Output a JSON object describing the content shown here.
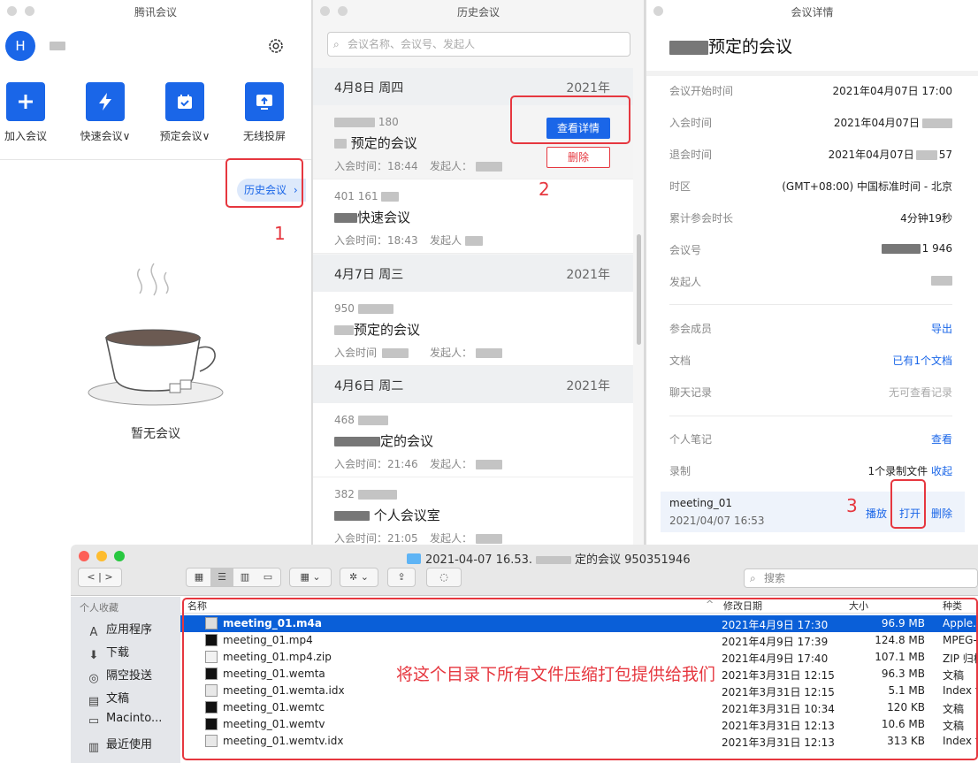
{
  "tencent_main": {
    "title": "腾讯会议",
    "avatar_letter": "H",
    "actions": [
      {
        "label": "加入会议",
        "icon": "plus-icon"
      },
      {
        "label": "快速会议∨",
        "icon": "lightning-icon"
      },
      {
        "label": "预定会议∨",
        "icon": "calendar-icon"
      },
      {
        "label": "无线投屏",
        "icon": "screen-cast-icon"
      }
    ],
    "history_button": "历史会议",
    "history_chevron": "›",
    "empty_text": "暂无会议",
    "annotation_1": "1"
  },
  "history": {
    "title": "历史会议",
    "search_placeholder": "会议名称、会议号、发起人",
    "groups": [
      {
        "date": "4月8日 周四",
        "year": "2021年"
      },
      {
        "date": "4月7日 周三",
        "year": "2021年"
      },
      {
        "date": "4月6日 周二",
        "year": "2021年"
      }
    ],
    "items": [
      {
        "id": "180",
        "name": "预定的会议",
        "time": "入会时间：18:44",
        "by": "发起人："
      },
      {
        "id": "401 161",
        "name": "快速会议",
        "time": "入会时间：18:43",
        "by": "发起人"
      },
      {
        "id": "950",
        "name": "预定的会议",
        "time": "入会时间",
        "by": "发起人："
      },
      {
        "id": "468",
        "name": "定的会议",
        "time": "入会时间：21:46",
        "by": "发起人："
      },
      {
        "id": "382",
        "name": "个人会议室",
        "time": "入会时间：21:05",
        "by": "发起人："
      }
    ],
    "detail_button": "查看详情",
    "delete_button": "删除",
    "annotation_2": "2"
  },
  "detail": {
    "window_title": "会议详情",
    "title": "预定的会议",
    "rows": [
      {
        "key": "会议开始时间",
        "value": "2021年04月07日 17:00"
      },
      {
        "key": "入会时间",
        "value": "2021年04月07日"
      },
      {
        "key": "退会时间",
        "value": "2021年04月07日"
      },
      {
        "key": "时区",
        "value": "(GMT+08:00) 中国标准时间 - 北京"
      },
      {
        "key": "累计参会时长",
        "value": "4分钟19秒"
      },
      {
        "key": "会议号",
        "value": "1 946"
      },
      {
        "key": "发起人",
        "value": ""
      }
    ],
    "leave_suffix": "57",
    "members_label": "参会成员",
    "members_action": "导出",
    "docs_label": "文档",
    "docs_value": "已有1个文档",
    "chat_label": "聊天记录",
    "chat_value": "无可查看记录",
    "notes_label": "个人笔记",
    "notes_action": "查看",
    "record_label": "录制",
    "record_value": "1个录制文件",
    "record_collapse": "收起",
    "record_name": "meeting_01",
    "record_date": "2021/04/07 16:53",
    "play": "播放",
    "open": "打开",
    "delete": "删除",
    "annotation_3": "3"
  },
  "finder": {
    "title_prefix": "2021-04-07 16.53.",
    "title_suffix": "定的会议 950351946",
    "search_placeholder": "搜索",
    "sidebar_header": "个人收藏",
    "sidebar": [
      {
        "label": "应用程序",
        "icon": "applications-icon",
        "glyph": "A"
      },
      {
        "label": "下载",
        "icon": "download-icon",
        "glyph": "⬇"
      },
      {
        "label": "隔空投送",
        "icon": "airdrop-icon",
        "glyph": "◎"
      },
      {
        "label": "文稿",
        "icon": "documents-icon",
        "glyph": "▤"
      },
      {
        "label": "Macinto...",
        "icon": "disk-icon",
        "glyph": "▭"
      },
      {
        "label": "最近使用",
        "icon": "recents-icon",
        "glyph": "▥"
      }
    ],
    "columns": {
      "name": "名称",
      "modified": "修改日期",
      "size": "大小",
      "kind": "种类"
    },
    "files": [
      {
        "name": "meeting_01.m4a",
        "date": "2021年4月9日 17:30",
        "size": "96.9 MB",
        "kind": "Apple...",
        "icon": "audio-file-icon"
      },
      {
        "name": "meeting_01.mp4",
        "date": "2021年4月9日 17:39",
        "size": "124.8 MB",
        "kind": "MPEG-",
        "icon": "video-file-icon"
      },
      {
        "name": "meeting_01.mp4.zip",
        "date": "2021年4月9日 17:40",
        "size": "107.1 MB",
        "kind": "ZIP 归档",
        "icon": "zip-file-icon"
      },
      {
        "name": "meeting_01.wemta",
        "date": "2021年3月31日 12:15",
        "size": "96.3 MB",
        "kind": "文稿",
        "icon": "black-file-icon"
      },
      {
        "name": "meeting_01.wemta.idx",
        "date": "2021年3月31日 12:15",
        "size": "5.1 MB",
        "kind": "Index fi",
        "icon": "index-file-icon"
      },
      {
        "name": "meeting_01.wemtc",
        "date": "2021年3月31日 10:34",
        "size": "120 KB",
        "kind": "文稿",
        "icon": "black-file-icon"
      },
      {
        "name": "meeting_01.wemtv",
        "date": "2021年3月31日 12:13",
        "size": "10.6 MB",
        "kind": "文稿",
        "icon": "black-file-icon"
      },
      {
        "name": "meeting_01.wemtv.idx",
        "date": "2021年3月31日 12:13",
        "size": "313 KB",
        "kind": "Index fi",
        "icon": "index-file-icon"
      }
    ],
    "note": "将这个目录下所有文件压缩打包提供给我们"
  }
}
